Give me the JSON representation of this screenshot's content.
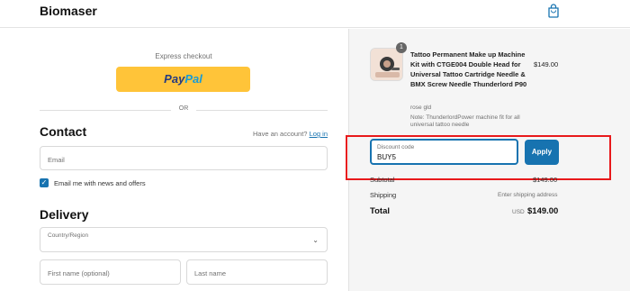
{
  "header": {
    "brand": "Biomaser",
    "cart_icon": "shopping-bag-icon"
  },
  "express": {
    "title": "Express checkout",
    "paypal_part1": "Pay",
    "paypal_part2": "Pal",
    "divider": "OR"
  },
  "contact": {
    "heading": "Contact",
    "have_account": "Have an account?",
    "login": "Log in",
    "email_placeholder": "Email",
    "newsletter_label": "Email me with news and offers",
    "newsletter_checked": true
  },
  "delivery": {
    "heading": "Delivery",
    "country_label": "Country/Region",
    "first_name_placeholder": "First name (optional)",
    "last_name_placeholder": "Last name"
  },
  "summary": {
    "product": {
      "quantity": "1",
      "name": "Tattoo Permanent Make up Machine Kit with CTGE004 Double Head for Universal Tattoo Cartridge Needle & BMX Screw Needle Thunderlord P90",
      "price": "$149.00",
      "variant": "rose gld",
      "note": "Note: ThunderlordPower machine fit for all universal tattoo needle"
    },
    "discount": {
      "label": "Discount code",
      "value": "BUY5",
      "apply": "Apply"
    },
    "subtotal_label": "Subtotal",
    "subtotal_value": "$149.00",
    "shipping_label": "Shipping",
    "shipping_value": "Enter shipping address",
    "total_label": "Total",
    "total_currency": "USD",
    "total_value": "$149.00"
  },
  "colors": {
    "accent": "#1773b0",
    "paypal_yellow": "#ffc439",
    "highlight": "#e8191b"
  }
}
